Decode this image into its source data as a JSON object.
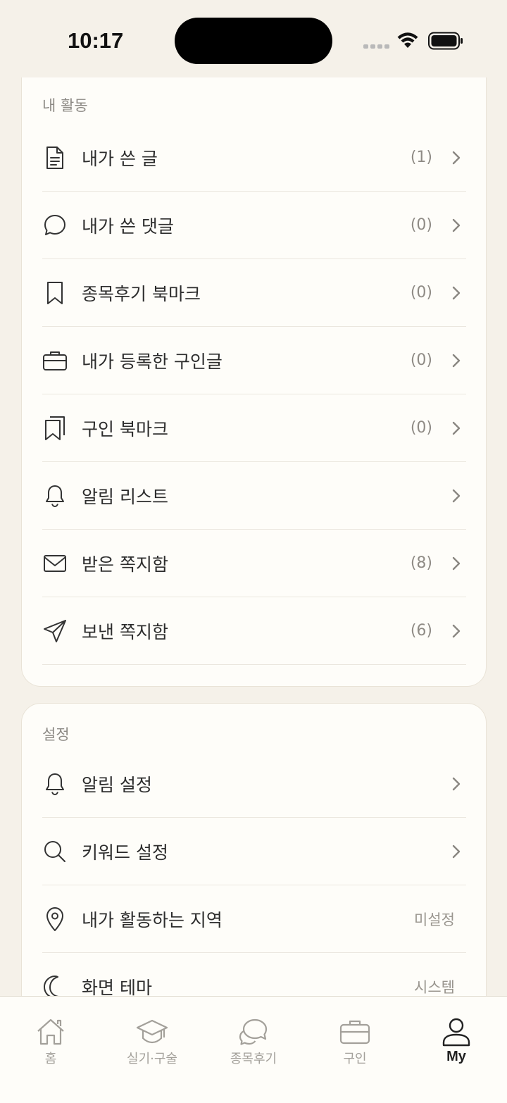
{
  "status_bar": {
    "time": "10:17"
  },
  "activity": {
    "title": "내 활동",
    "items": [
      {
        "label": "내가 쓴 글",
        "count": "(1)",
        "icon": "document-icon"
      },
      {
        "label": "내가 쓴 댓글",
        "count": "(0)",
        "icon": "comment-icon"
      },
      {
        "label": "종목후기 북마크",
        "count": "(0)",
        "icon": "bookmark-icon"
      },
      {
        "label": "내가 등록한 구인글",
        "count": "(0)",
        "icon": "briefcase-icon"
      },
      {
        "label": "구인 북마크",
        "count": "(0)",
        "icon": "bookmarks-icon"
      },
      {
        "label": "알림 리스트",
        "count": "",
        "icon": "bell-icon"
      },
      {
        "label": "받은 쪽지함",
        "count": "(8)",
        "icon": "envelope-icon"
      },
      {
        "label": "보낸 쪽지함",
        "count": "(6)",
        "icon": "send-icon"
      }
    ]
  },
  "settings": {
    "title": "설정",
    "items": [
      {
        "label": "알림 설정",
        "value": "",
        "icon": "bell-icon"
      },
      {
        "label": "키워드 설정",
        "value": "",
        "icon": "search-icon"
      },
      {
        "label": "내가 활동하는 지역",
        "value": "미설정",
        "icon": "location-pin-icon"
      },
      {
        "label": "화면 테마",
        "value": "시스템",
        "icon": "moon-icon"
      }
    ]
  },
  "tab_bar": {
    "tabs": [
      {
        "label": "홈",
        "icon": "home-icon",
        "active": false
      },
      {
        "label": "실기·구술",
        "icon": "graduation-cap-icon",
        "active": false
      },
      {
        "label": "종목후기",
        "icon": "chat-bubbles-icon",
        "active": false
      },
      {
        "label": "구인",
        "icon": "briefcase-icon",
        "active": false
      },
      {
        "label": "My",
        "icon": "person-icon",
        "active": true
      }
    ]
  },
  "colors": {
    "background": "#f5f1e9",
    "card": "#fefdf9",
    "text": "#2d2d2d",
    "muted": "#8f8b85"
  }
}
